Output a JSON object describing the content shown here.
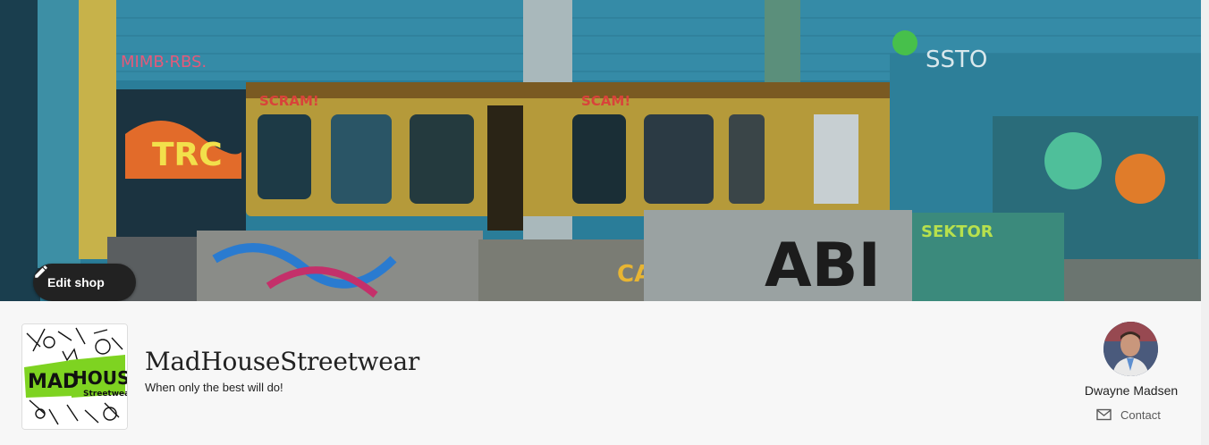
{
  "banner": {
    "alt": "Graffiti-covered abandoned warehouse with old tram cars",
    "edit_shop_label": "Edit shop"
  },
  "shop": {
    "name": "MadHouseStreetwear",
    "tagline": "When only the best will do!",
    "logo_text_line1": "MAD",
    "logo_text_line2": "HOUSE",
    "logo_text_line3": "Streetwear"
  },
  "owner": {
    "name": "Dwayne Madsen",
    "contact_label": "Contact"
  },
  "colors": {
    "button_bg": "#222222",
    "logo_accent": "#7ed321",
    "page_bg": "#f7f7f7"
  }
}
